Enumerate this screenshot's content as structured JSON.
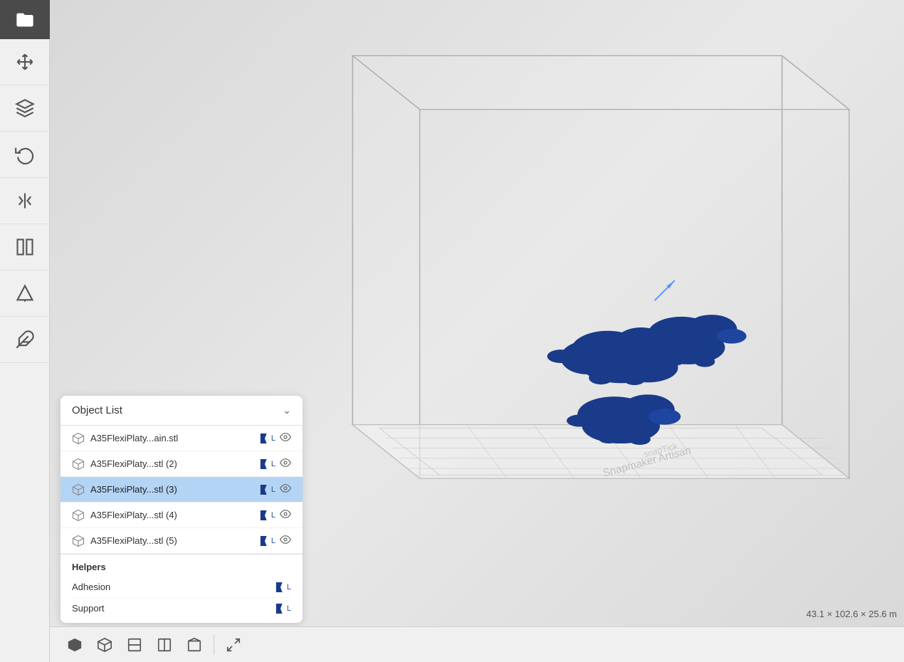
{
  "toolbar": {
    "open_label": "Open folder"
  },
  "panel": {
    "title": "Object List",
    "collapse_label": "▾",
    "objects": [
      {
        "id": 1,
        "name": "A35FlexiPlaty...ain.stl",
        "selected": false,
        "flag": "L",
        "has_eye": true
      },
      {
        "id": 2,
        "name": "A35FlexiPlaty...stl (2)",
        "selected": false,
        "flag": "L",
        "has_eye": true
      },
      {
        "id": 3,
        "name": "A35FlexiPlaty...stl (3)",
        "selected": true,
        "flag": "L",
        "has_eye": true
      },
      {
        "id": 4,
        "name": "A35FlexiPlaty...stl (4)",
        "selected": false,
        "flag": "L",
        "has_eye": true
      },
      {
        "id": 5,
        "name": "A35FlexiPlaty...stl (5)",
        "selected": false,
        "flag": "L",
        "has_eye": true
      }
    ],
    "helpers_title": "Helpers",
    "helpers": [
      {
        "name": "Adhesion",
        "flag": "L"
      },
      {
        "name": "Support",
        "flag": "L"
      }
    ]
  },
  "bottom_toolbar": {
    "icons": [
      "cube-solid",
      "cube-outline",
      "box-front",
      "box-left",
      "box-right",
      "arrows-collapse"
    ]
  },
  "dimension": {
    "text": "43.1 × 102.6 × 25.6 m"
  },
  "watermark": "Snapmaker Artisan"
}
